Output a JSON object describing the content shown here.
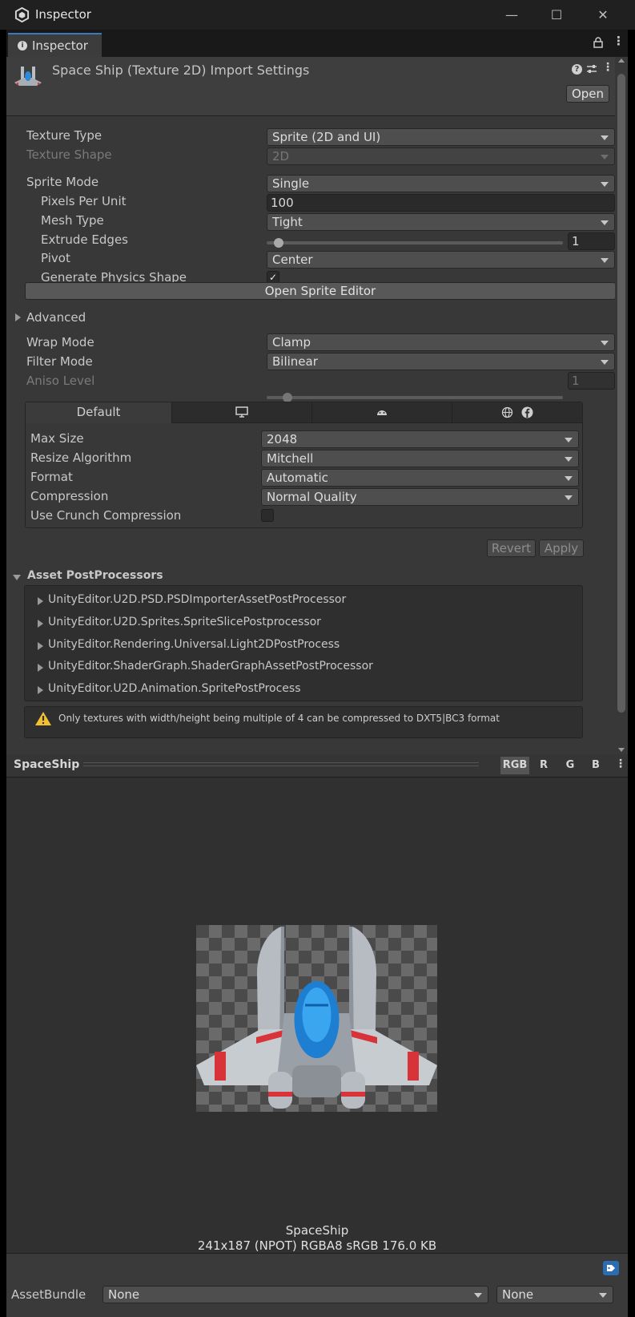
{
  "window": {
    "title": "Inspector",
    "controls": [
      "—",
      "☐",
      "✕"
    ]
  },
  "tab": {
    "label": "Inspector"
  },
  "header": {
    "title": "Space Ship (Texture 2D) Import Settings",
    "open_button": "Open"
  },
  "settings": {
    "texture_type": {
      "label": "Texture Type",
      "value": "Sprite (2D and UI)"
    },
    "texture_shape": {
      "label": "Texture Shape",
      "value": "2D"
    },
    "sprite_mode": {
      "label": "Sprite Mode",
      "value": "Single"
    },
    "pixels_per_unit": {
      "label": "Pixels Per Unit",
      "value": "100"
    },
    "mesh_type": {
      "label": "Mesh Type",
      "value": "Tight"
    },
    "extrude_edges": {
      "label": "Extrude Edges",
      "value": "1",
      "level": 0.03
    },
    "pivot": {
      "label": "Pivot",
      "value": "Center"
    },
    "generate_physics_shape": {
      "label": "Generate Physics Shape",
      "checked": true
    },
    "open_sprite_editor": "Open Sprite Editor",
    "advanced": "Advanced",
    "wrap_mode": {
      "label": "Wrap Mode",
      "value": "Clamp"
    },
    "filter_mode": {
      "label": "Filter Mode",
      "value": "Bilinear"
    },
    "aniso_level": {
      "label": "Aniso Level",
      "value": "1",
      "level": 0.06
    }
  },
  "platform": {
    "tabs": [
      "Default",
      "monitor-icon",
      "android-icon",
      "web-icon facebook-icon"
    ],
    "default_tab": "Default",
    "max_size": {
      "label": "Max Size",
      "value": "2048"
    },
    "resize_algorithm": {
      "label": "Resize Algorithm",
      "value": "Mitchell"
    },
    "format": {
      "label": "Format",
      "value": "Automatic"
    },
    "compression": {
      "label": "Compression",
      "value": "Normal Quality"
    },
    "use_crunch": {
      "label": "Use Crunch Compression",
      "checked": false
    }
  },
  "actions": {
    "revert": "Revert",
    "apply": "Apply"
  },
  "postprocessors": {
    "title": "Asset PostProcessors",
    "items": [
      "UnityEditor.U2D.PSD.PSDImporterAssetPostProcessor",
      "UnityEditor.U2D.Sprites.SpriteSlicePostprocessor",
      "UnityEditor.Rendering.Universal.Light2DPostProcess",
      "UnityEditor.ShaderGraph.ShaderGraphAssetPostProcessor",
      "UnityEditor.U2D.Animation.SpritePostProcess"
    ],
    "warning": "Only textures with width/height being multiple of 4 can be compressed to DXT5|BC3 format"
  },
  "preview": {
    "name": "SpaceShip",
    "channels": [
      "RGB",
      "R",
      "G",
      "B"
    ],
    "caption_name": "SpaceShip",
    "caption_info": "241x187 (NPOT)  RGBA8 sRGB   176.0 KB"
  },
  "asset_bundle": {
    "label": "AssetBundle",
    "name": "None",
    "variant": "None"
  },
  "colors": {
    "accent": "#3a79bb",
    "warning": "#f2c12e",
    "background": "#383838"
  }
}
